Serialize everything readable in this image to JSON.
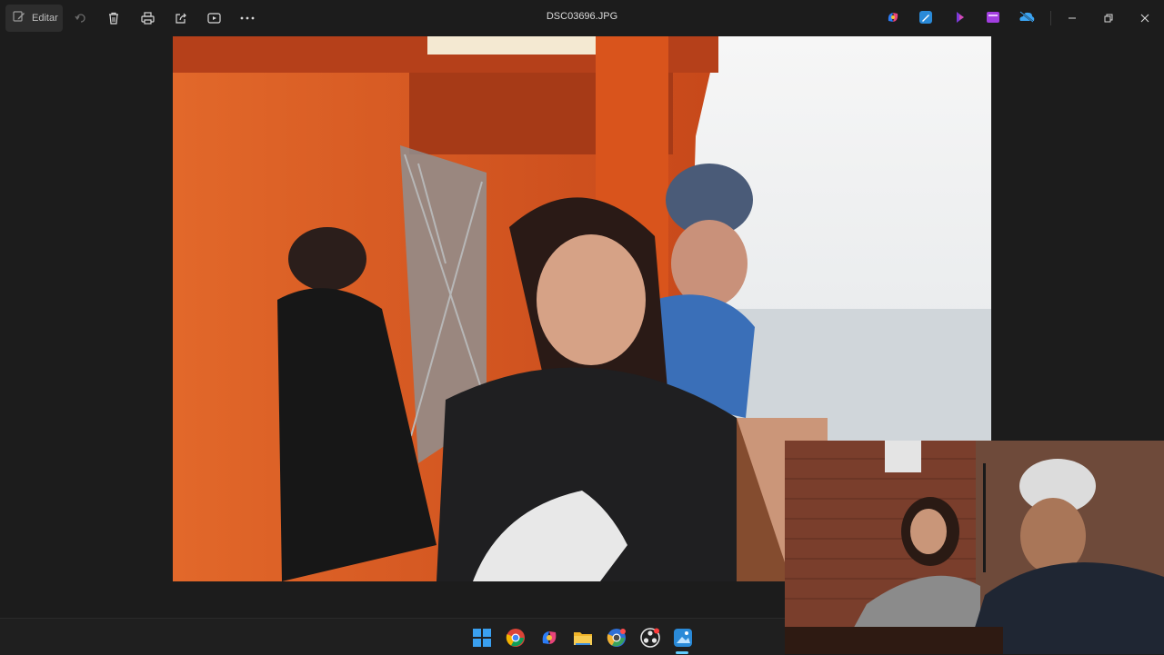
{
  "toolbar": {
    "edit_label": "Editar",
    "icons": [
      "edit-icon",
      "rotate-icon",
      "trash-icon",
      "print-icon",
      "share-icon",
      "slideshow-icon",
      "more-icon"
    ]
  },
  "window": {
    "title": "DSC03696.JPG"
  },
  "app_icons": [
    "copilot-icon",
    "photos-editor-icon",
    "clipchamp-icon",
    "media-icon",
    "onedrive-icon"
  ],
  "window_controls": [
    "minimize-icon",
    "restore-icon",
    "close-icon"
  ],
  "taskbar": {
    "icons": [
      "windows-start-icon",
      "chrome-icon",
      "copilot-icon",
      "file-explorer-icon",
      "chrome-dev-icon",
      "obs-icon",
      "photos-icon"
    ],
    "active": "photos-icon"
  },
  "colors": {
    "bg": "#1c1c1c",
    "accent": "#60cdff",
    "ferry_orange": "#d2531d"
  }
}
